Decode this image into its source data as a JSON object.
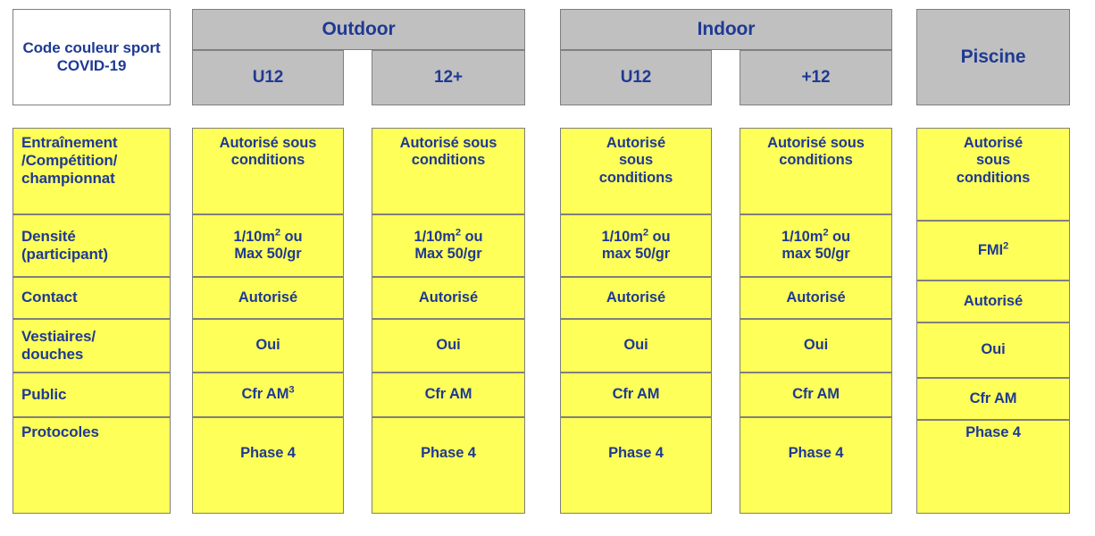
{
  "title_cell": {
    "label": "Code couleur sport COVID-19"
  },
  "header": {
    "groups": [
      {
        "name": "outdoor-group",
        "label": "Outdoor",
        "sub": [
          {
            "name": "outdoor-u12",
            "label": "U12"
          },
          {
            "name": "outdoor-12plus",
            "label": "12+"
          }
        ]
      },
      {
        "name": "indoor-group",
        "label": "Indoor",
        "sub": [
          {
            "name": "indoor-u12",
            "label": "U12"
          },
          {
            "name": "indoor-plus12",
            "label": "+12"
          }
        ]
      }
    ],
    "single": {
      "name": "piscine",
      "label": "Piscine"
    }
  },
  "colors": {
    "header_gray": "#C0C0C0",
    "cell_yellow": "#FFFF59",
    "text_blue": "#1F3A93",
    "border_gray": "#7F7F7F",
    "page_background": "#FFFFFF"
  },
  "rows": [
    {
      "label": "Entraînement /Compétition/ championnat",
      "label_lines": [
        "Entraînement",
        "/Compétition/",
        "championnat"
      ],
      "cells": [
        {
          "lines": [
            "Autorisé sous",
            "conditions"
          ]
        },
        {
          "lines": [
            "Autorisé sous",
            "conditions"
          ]
        },
        {
          "lines": [
            "Autorisé",
            "sous",
            "conditions"
          ]
        },
        {
          "lines": [
            "Autorisé sous",
            "conditions"
          ]
        },
        {
          "lines": [
            "Autorisé",
            "sous",
            "conditions"
          ]
        }
      ]
    },
    {
      "label": "Densité (participant)",
      "label_lines": [
        "Densité",
        "(participant)"
      ],
      "cells": [
        {
          "lines": [
            "1/10m² ou",
            "Max 50/gr"
          ]
        },
        {
          "lines": [
            "1/10m² ou",
            "Max 50/gr"
          ]
        },
        {
          "lines": [
            "1/10m² ou",
            "max 50/gr"
          ]
        },
        {
          "lines": [
            "1/10m² ou",
            "max 50/gr"
          ]
        },
        {
          "lines": [
            "FMI²"
          ]
        }
      ]
    },
    {
      "label": "Contact",
      "label_lines": [
        "Contact"
      ],
      "cells": [
        {
          "lines": [
            "Autorisé"
          ]
        },
        {
          "lines": [
            "Autorisé"
          ]
        },
        {
          "lines": [
            "Autorisé"
          ]
        },
        {
          "lines": [
            "Autorisé"
          ]
        },
        {
          "lines": [
            "Autorisé"
          ]
        }
      ]
    },
    {
      "label": "Vestiaires/ douches",
      "label_lines": [
        "Vestiaires/",
        "douches"
      ],
      "cells": [
        {
          "lines": [
            "Oui"
          ]
        },
        {
          "lines": [
            "Oui"
          ]
        },
        {
          "lines": [
            "Oui"
          ]
        },
        {
          "lines": [
            "Oui"
          ]
        },
        {
          "lines": [
            "Oui"
          ]
        }
      ]
    },
    {
      "label": "Public",
      "label_lines": [
        "Public"
      ],
      "cells": [
        {
          "lines": [
            "Cfr AM³"
          ]
        },
        {
          "lines": [
            "Cfr AM"
          ]
        },
        {
          "lines": [
            "Cfr AM"
          ]
        },
        {
          "lines": [
            "Cfr AM"
          ]
        },
        {
          "lines": [
            "Cfr AM"
          ]
        }
      ]
    },
    {
      "label": "Protocoles",
      "label_lines": [
        "Protocoles"
      ],
      "cells": [
        {
          "lines": [
            "Phase 4"
          ]
        },
        {
          "lines": [
            "Phase 4"
          ]
        },
        {
          "lines": [
            "Phase 4"
          ]
        },
        {
          "lines": [
            "Phase 4"
          ]
        },
        {
          "lines": [
            "Phase 4"
          ]
        }
      ]
    }
  ]
}
